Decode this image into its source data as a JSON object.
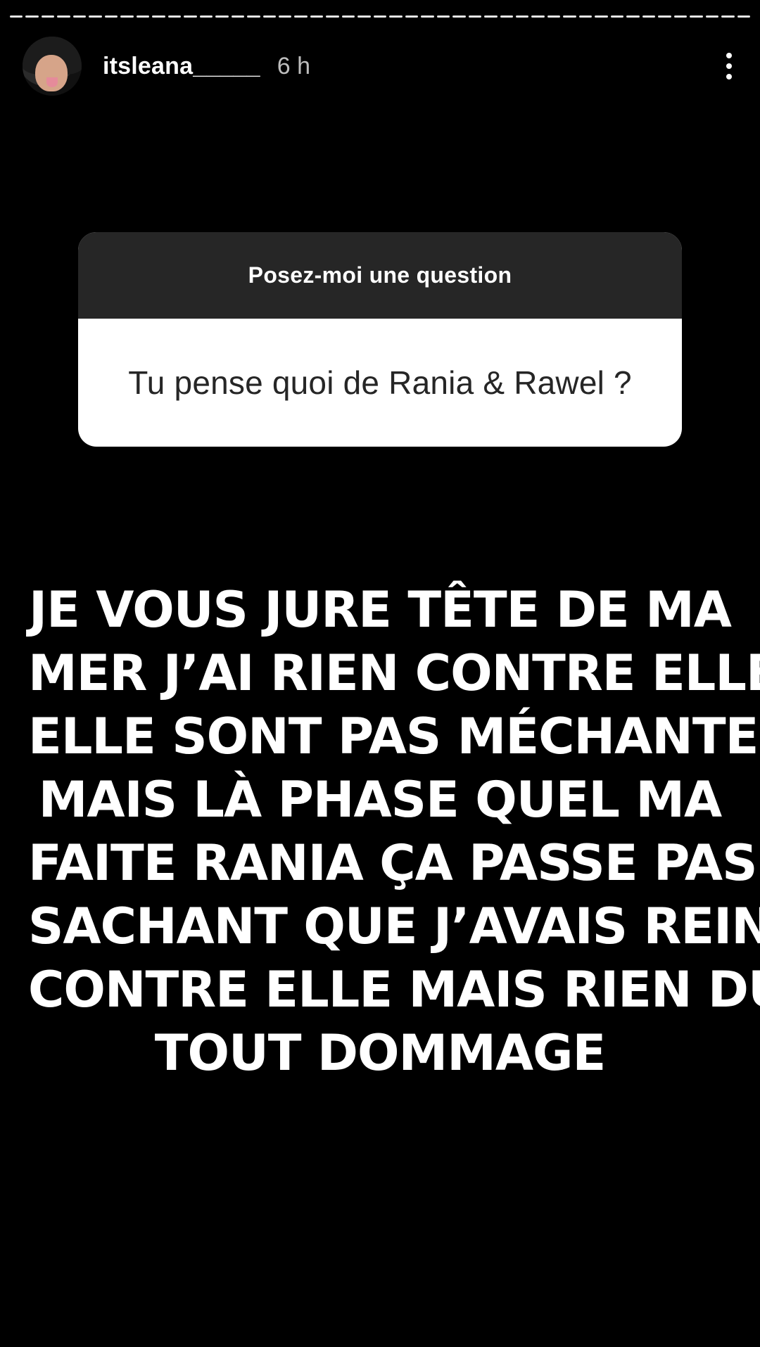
{
  "story": {
    "progress_segments": 47,
    "progress_done": 47,
    "progress_colors": {
      "done": "#e6e6e6",
      "pending": "#5a5a5a"
    }
  },
  "header": {
    "username": "itsleana_____",
    "time": "6 h",
    "avatar_icon": "profile-photo",
    "more_icon": "more-vertical-icon"
  },
  "sticker": {
    "title": "Posez-moi une question",
    "question": "Tu pense quoi de Rania & Rawel ?",
    "head_color": "#262626",
    "body_color": "#ffffff"
  },
  "caption": {
    "lines": [
      "JE VOUS JURE TÊTE DE MA",
      "MER J’AI RIEN CONTRE ELLE",
      "ELLE SONT PAS MÉCHANTE",
      "MAIS LÀ PHASE QUEL MA",
      "FAITE RANIA ÇA PASSE PAS",
      "SACHANT QUE J’AVAIS REIN",
      "CONTRE ELLE MAIS RIEN DU",
      "TOUT DOMMAGE"
    ]
  }
}
